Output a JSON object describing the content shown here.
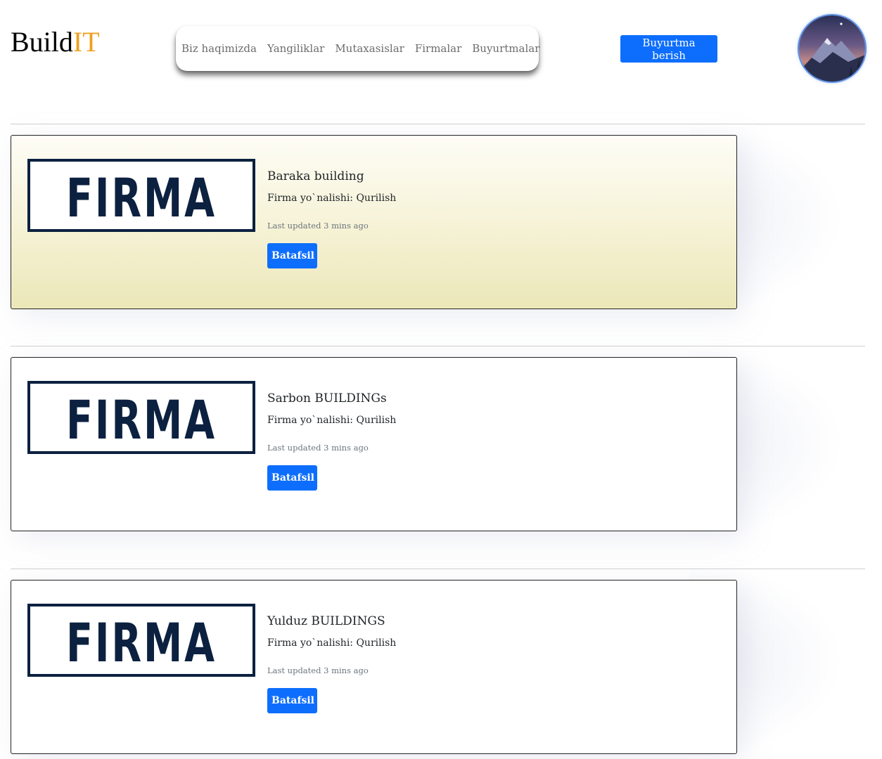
{
  "header": {
    "brand_main": "Build",
    "brand_accent": "IT",
    "brand_accent_color": "#f0a020",
    "nav": [
      {
        "label": "Biz haqimizda"
      },
      {
        "label": "Yangiliklar"
      },
      {
        "label": "Mutaxasislar"
      },
      {
        "label": "Firmalar"
      },
      {
        "label": "Buyurtmalar"
      }
    ],
    "order_button_label": "Buyurtma berish",
    "avatar_icon": "mountain-landscape-avatar"
  },
  "colors": {
    "primary": "#0d6efd",
    "logo_navy": "#0c2140",
    "highlight_gradient_end": "#ebe7b8"
  },
  "cards": [
    {
      "logo_text": "FIRMA",
      "title": "Baraka building",
      "field": "Firma yo`nalishi: Qurilish",
      "updated": "Last updated 3 mins ago",
      "button_label": "Batafsil",
      "highlighted": true
    },
    {
      "logo_text": "FIRMA",
      "title": "Sarbon BUILDINGs",
      "field": "Firma yo`nalishi: Qurilish",
      "updated": "Last updated 3 mins ago",
      "button_label": "Batafsil",
      "highlighted": false
    },
    {
      "logo_text": "FIRMA",
      "title": "Yulduz BUILDINGS",
      "field": "Firma yo`nalishi: Qurilish",
      "updated": "Last updated 3 mins ago",
      "button_label": "Batafsil",
      "highlighted": false
    }
  ]
}
